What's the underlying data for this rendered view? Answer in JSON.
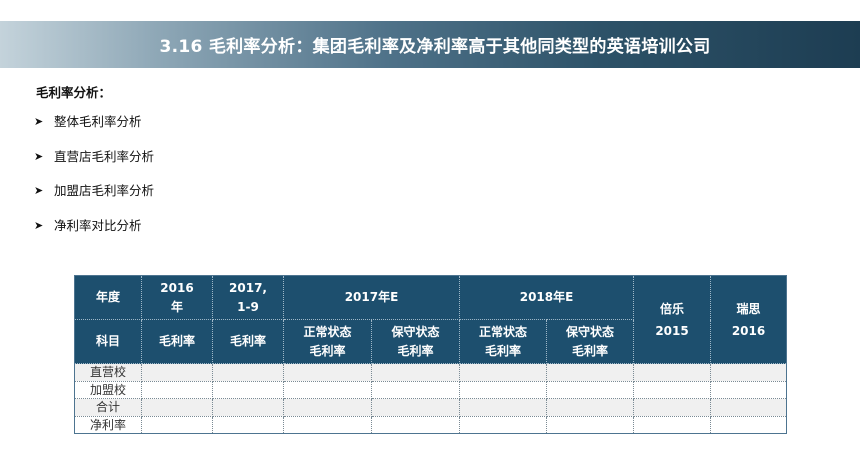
{
  "banner": {
    "title": "3.16  毛利率分析：集团毛利率及净利率高于其他同类型的英语培训公司"
  },
  "section": {
    "title": "毛利率分析：",
    "bullets": [
      "整体毛利率分析",
      "直营店毛利率分析",
      "加盟店毛利率分析",
      "净利率对比分析"
    ]
  },
  "table": {
    "h1": {
      "year_label": "年度",
      "c2016": "2016\n年",
      "c2017_9": "2017,\n1-9",
      "c2017e": "2017年E",
      "c2018e": "2018年E",
      "beile": "倍乐\n2015",
      "ruisi": "瑞思\n2016"
    },
    "h2": {
      "subject_label": "科目",
      "gm1": "毛利率",
      "gm2": "毛利率",
      "normal_2017": "正常状态\n毛利率",
      "conservative_2017": "保守状态\n毛利率",
      "normal_2018": "正常状态\n毛利率",
      "conservative_2018": "保守状态\n毛利率"
    },
    "rows": [
      "直营校",
      "加盟校",
      "合计",
      "净利率"
    ]
  }
}
